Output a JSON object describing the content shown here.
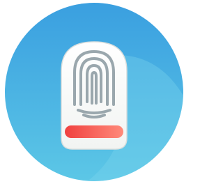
{
  "app_icon": {
    "name": "fingerprint-app-icon",
    "icon": "fingerprint-icon",
    "colors": {
      "circle_top": "#3a9fe0",
      "circle_bottom": "#5cc7e6",
      "highlight": "#7fd6ee",
      "card": "#f2f4f2",
      "card_top": "#ffffff",
      "ridge": "#9aa7ad",
      "bar_left": "#f0413f",
      "bar_right": "#ff8a7a"
    }
  }
}
